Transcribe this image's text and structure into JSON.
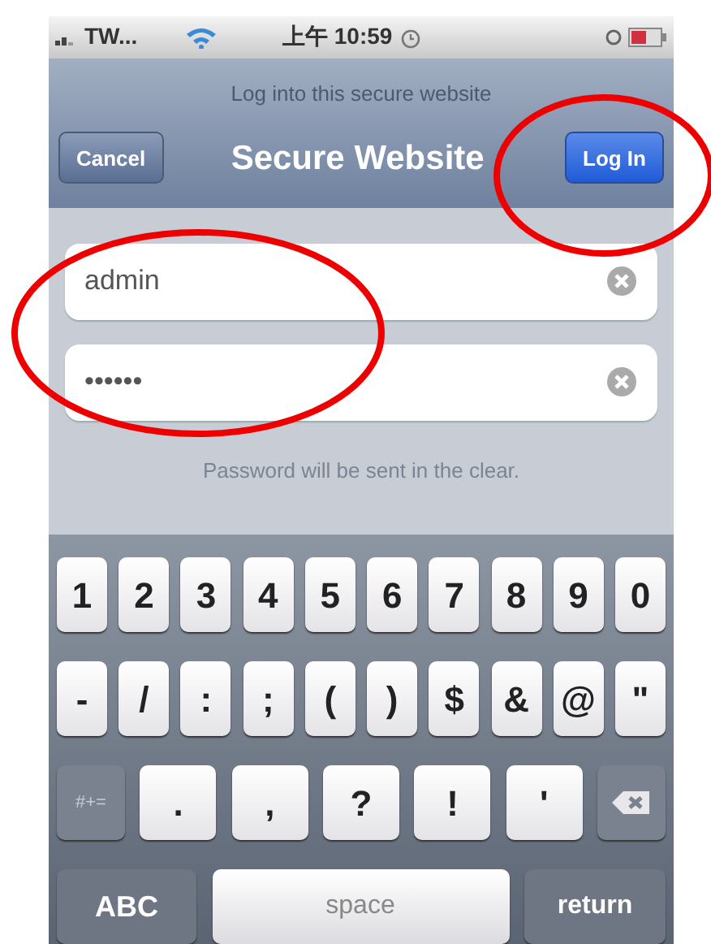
{
  "status_bar": {
    "carrier": "TW...",
    "time": "上午 10:59"
  },
  "prompt": "Log into this secure website",
  "nav": {
    "cancel": "Cancel",
    "title": "Secure Website",
    "login": "Log In"
  },
  "fields": [
    {
      "value": "admin"
    },
    {
      "value": "••••••"
    }
  ],
  "note": "Password will be sent in the clear.",
  "keyboard": [
    [
      {
        "kind": "char",
        "label": "1"
      },
      {
        "kind": "char",
        "label": "2"
      },
      {
        "kind": "char",
        "label": "3"
      },
      {
        "kind": "char",
        "label": "4"
      },
      {
        "kind": "char",
        "label": "5"
      },
      {
        "kind": "char",
        "label": "6"
      },
      {
        "kind": "char",
        "label": "7"
      },
      {
        "kind": "char",
        "label": "8"
      },
      {
        "kind": "char",
        "label": "9"
      },
      {
        "kind": "char",
        "label": "0"
      }
    ],
    [
      {
        "kind": "char",
        "label": "-"
      },
      {
        "kind": "char",
        "label": "/"
      },
      {
        "kind": "char",
        "label": ":"
      },
      {
        "kind": "char",
        "label": ";"
      },
      {
        "kind": "char",
        "label": "("
      },
      {
        "kind": "char",
        "label": ")"
      },
      {
        "kind": "char",
        "label": "$"
      },
      {
        "kind": "char",
        "label": "&"
      },
      {
        "kind": "char",
        "label": "@"
      },
      {
        "kind": "char",
        "label": "\""
      }
    ],
    [
      {
        "kind": "mode",
        "label": "#+="
      },
      {
        "kind": "wide",
        "label": "."
      },
      {
        "kind": "wide",
        "label": ","
      },
      {
        "kind": "wide",
        "label": "?"
      },
      {
        "kind": "wide",
        "label": "!"
      },
      {
        "kind": "wide",
        "label": "'"
      },
      {
        "kind": "delete"
      }
    ],
    [
      {
        "kind": "abc",
        "label": "ABC"
      },
      {
        "kind": "space",
        "label": "space"
      },
      {
        "kind": "return",
        "label": "return"
      }
    ]
  ]
}
